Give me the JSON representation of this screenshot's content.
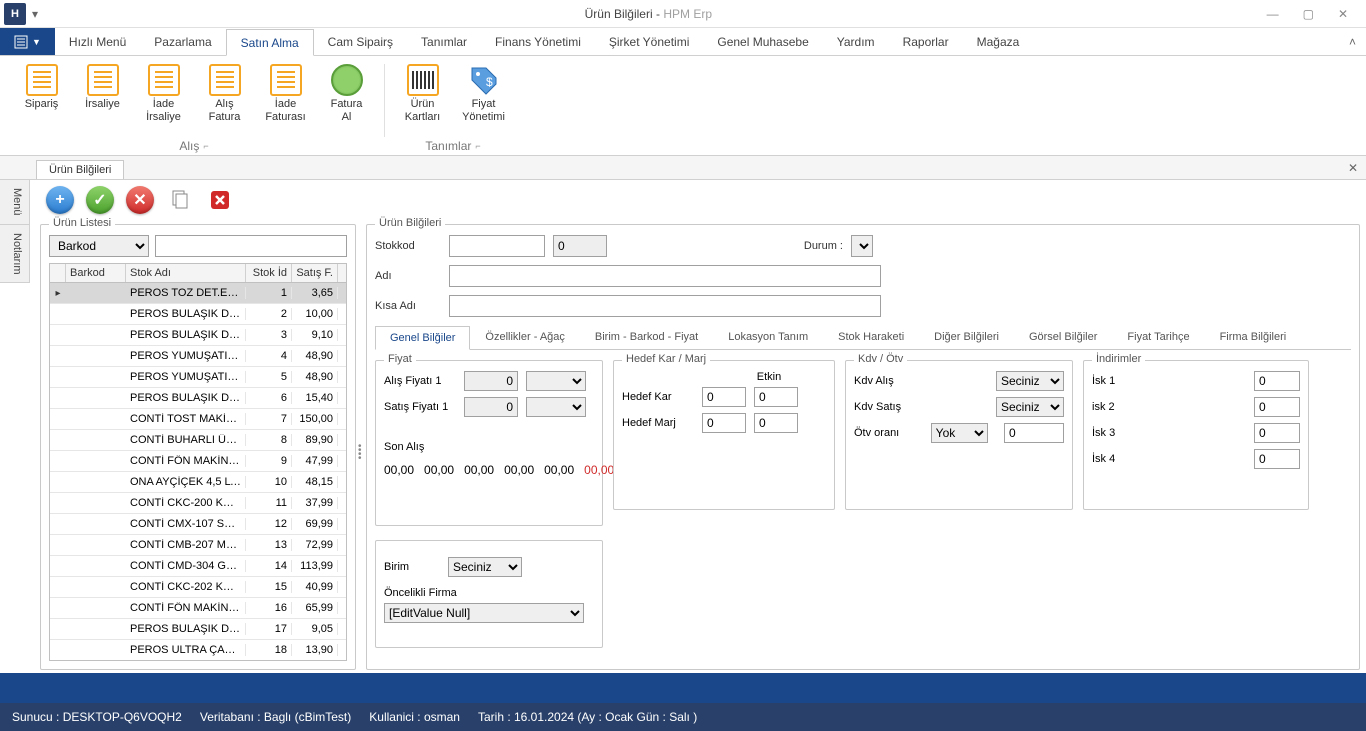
{
  "title": {
    "main": "Ürün Bilğileri",
    "sub": "HPM Erp"
  },
  "menuTabs": [
    "Hızlı Menü",
    "Pazarlama",
    "Satın Alma",
    "Cam Sipairş",
    "Tanımlar",
    "Finans Yönetimi",
    "Şirket Yönetimi",
    "Genel Muhasebe",
    "Yardım",
    "Raporlar",
    "Mağaza"
  ],
  "activeMenuTab": 2,
  "ribbon": {
    "group1": {
      "label": "Alış",
      "buttons": [
        "Sipariş",
        "İrsaliye",
        "İade İrsaliye",
        "Alış Fatura",
        "İade Faturası",
        "Fatura Al"
      ]
    },
    "group2": {
      "label": "Tanımlar",
      "buttons": [
        "Ürün Kartları",
        "Fiyat Yönetimi"
      ]
    }
  },
  "docTab": "Ürün Bilğileri",
  "sideTabs": [
    "Menü",
    "Notlarım"
  ],
  "leftPanel": {
    "title": "Ürün Listesi",
    "filterSelect": "Barkod",
    "filterValue": "",
    "columns": [
      "Barkod",
      "Stok Adı",
      "Stok İd",
      "Satış F."
    ],
    "rows": [
      {
        "barkod": "",
        "ad": "PEROS TOZ DET.ELD…",
        "id": 1,
        "fiyat": "3,65",
        "sel": true
      },
      {
        "barkod": "",
        "ad": "PEROS BULAŞIK DET…",
        "id": 2,
        "fiyat": "10,00"
      },
      {
        "barkod": "",
        "ad": "PEROS BULAŞIK DET…",
        "id": 3,
        "fiyat": "9,10"
      },
      {
        "barkod": "",
        "ad": "PEROS YUMUŞATICI …",
        "id": 4,
        "fiyat": "48,90"
      },
      {
        "barkod": "",
        "ad": "PEROS YUMUŞATICI …",
        "id": 5,
        "fiyat": "48,90"
      },
      {
        "barkod": "",
        "ad": "PEROS BULAŞIK DET…",
        "id": 6,
        "fiyat": "15,40"
      },
      {
        "barkod": "",
        "ad": "CONTİ TOST MAKİNA…",
        "id": 7,
        "fiyat": "150,00"
      },
      {
        "barkod": "",
        "ad": "CONTİ BUHARLI ÜTÜ…",
        "id": 8,
        "fiyat": "89,90"
      },
      {
        "barkod": "",
        "ad": "CONTİ FÖN MAKİNA…",
        "id": 9,
        "fiyat": "47,99"
      },
      {
        "barkod": "",
        "ad": "ONA AYÇİÇEK 4,5 LT…",
        "id": 10,
        "fiyat": "48,15"
      },
      {
        "barkod": "",
        "ad": "CONTİ CKC-200 KEYİ…",
        "id": 11,
        "fiyat": "37,99"
      },
      {
        "barkod": "",
        "ad": "CONTİ CMX-107 SAF…",
        "id": 12,
        "fiyat": "69,99"
      },
      {
        "barkod": "",
        "ad": "CONTİ CMB-207 MUL…",
        "id": 13,
        "fiyat": "72,99"
      },
      {
        "barkod": "",
        "ad": "CONTİ CMD-304 GUS…",
        "id": 14,
        "fiyat": "113,99"
      },
      {
        "barkod": "",
        "ad": "CONTİ CKC-202 KEYİ…",
        "id": 15,
        "fiyat": "40,99"
      },
      {
        "barkod": "",
        "ad": "CONTİ FÖN MAKİNA…",
        "id": 16,
        "fiyat": "65,99"
      },
      {
        "barkod": "",
        "ad": "PEROS BULAŞIK DET…",
        "id": 17,
        "fiyat": "9,05"
      },
      {
        "barkod": "",
        "ad": "PEROS ULTRA ÇAMA…",
        "id": 18,
        "fiyat": "13,90"
      }
    ]
  },
  "rightPanel": {
    "title": "Ürün Bilğileri",
    "labels": {
      "stokkod": "Stokkod",
      "stokkodSide": "0",
      "durum": "Durum :",
      "adi": "Adı",
      "kisaAdi": "Kısa Adı"
    },
    "innerTabs": [
      "Genel Bilğiler",
      "Özellikler  - Ağaç",
      "Birim - Barkod - Fiyat",
      "Lokasyon Tanım",
      "Stok Haraketi",
      "Diğer Bilğileri",
      "Görsel Bilğiler",
      "Fiyat Tarihçe",
      "Firma Bilğileri"
    ],
    "activeInnerTab": 0,
    "fiyat": {
      "title": "Fiyat",
      "alisLabel": "Alış Fiyatı 1",
      "alisVal": "0",
      "satisLabel": "Satış Fiyatı 1",
      "satisVal": "0",
      "sonAlisLabel": "Son Alış",
      "sonAlisVals": [
        "00,00",
        "00,00",
        "00,00",
        "00,00",
        "00,00",
        "00,00"
      ]
    },
    "hedef": {
      "title": "Hedef Kar / Marj",
      "etkin": "Etkin",
      "karLabel": "Hedef Kar",
      "karVal": "0",
      "karEtkin": "0",
      "marjLabel": "Hedef Marj",
      "marjVal": "0",
      "marjEtkin": "0"
    },
    "kdv": {
      "title": "Kdv / Ötv",
      "alisLabel": "Kdv Alış",
      "alisSel": "Seciniz",
      "satisLabel": "Kdv Satış",
      "satisSel": "Seciniz",
      "otvLabel": "Ötv oranı",
      "otvSel": "Yok",
      "otvVal": "0"
    },
    "indirim": {
      "title": "İndirimler",
      "rows": [
        {
          "label": "İsk 1",
          "val": "0"
        },
        {
          "label": "isk 2",
          "val": "0"
        },
        {
          "label": "İsk 3",
          "val": "0"
        },
        {
          "label": "İsk 4",
          "val": "0"
        }
      ]
    },
    "birim": {
      "label": "Birim",
      "sel": "Seciniz",
      "oncelikLabel": "Öncelikli Firma",
      "oncelikVal": "[EditValue Null]"
    }
  },
  "status": {
    "sunucu": "Sunucu : DESKTOP-Q6VOQH2",
    "veritabani": "Veritabanı : Baglı (cBimTest)",
    "kullanici": "Kullanici : osman",
    "tarih": "Tarih : 16.01.2024 (Ay : Ocak Gün : Salı )"
  }
}
